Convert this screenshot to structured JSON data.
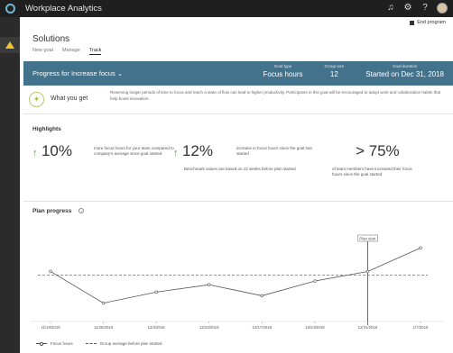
{
  "app": {
    "title": "Workplace Analytics"
  },
  "header": {
    "end_program": "End program"
  },
  "page": {
    "title": "Solutions",
    "tabs": [
      "New goal",
      "Manage",
      "Track"
    ]
  },
  "banner": {
    "progress_label": "Progress for",
    "goal_selected": "Increase focus",
    "goal_type_label": "Goal type",
    "goal_type_value": "Focus hours",
    "group_size_label": "Group size",
    "group_size_value": "12",
    "goal_duration_label": "Goal duration",
    "goal_duration_value": "Started on Dec 31, 2018"
  },
  "what_you_get": {
    "title": "What you get",
    "text": "Reserving longer periods of time to focus and reach a state of flow can lead to higher productivity. Participants in this goal will be encouraged to adopt work and collaboration habits that help boost innovation."
  },
  "highlights": {
    "title": "Highlights",
    "items": [
      {
        "value": "10%",
        "text": "more focus hours for your team compared to company's average since goal started"
      },
      {
        "value": "12%",
        "text": "increase in focus hours since the goal has started"
      },
      {
        "value": "> 75%",
        "text": "of team members have increased their focus hours since the goal started"
      }
    ],
    "benchmark_note": "Benchmark values are based on 12 weeks before plan started"
  },
  "plan_progress": {
    "title": "Plan progress",
    "legend_focus": "Focus hours",
    "legend_avg": "Group average before plan started",
    "plan_start_label": "Plan start"
  },
  "chart_data": {
    "type": "line",
    "x": [
      "11/19/2018",
      "11/26/2018",
      "12/3/2018",
      "12/10/2018",
      "12/17/2018",
      "12/24/2018",
      "12/31/2018",
      "1/7/2019"
    ],
    "series": [
      {
        "name": "Focus hours",
        "values": [
          6.8,
          2.5,
          4.0,
          5.0,
          3.5,
          5.5,
          6.8,
          10.0
        ]
      },
      {
        "name": "Group average before plan started",
        "values": [
          6.3,
          6.3,
          6.3,
          6.3,
          6.3,
          6.3,
          6.3,
          6.3
        ]
      }
    ],
    "ylim": [
      0,
      12
    ],
    "annotations": [
      {
        "x": "12/31/2018",
        "text": "Plan start"
      }
    ],
    "colors": {
      "line": "#555555",
      "avg": "#555555"
    }
  }
}
